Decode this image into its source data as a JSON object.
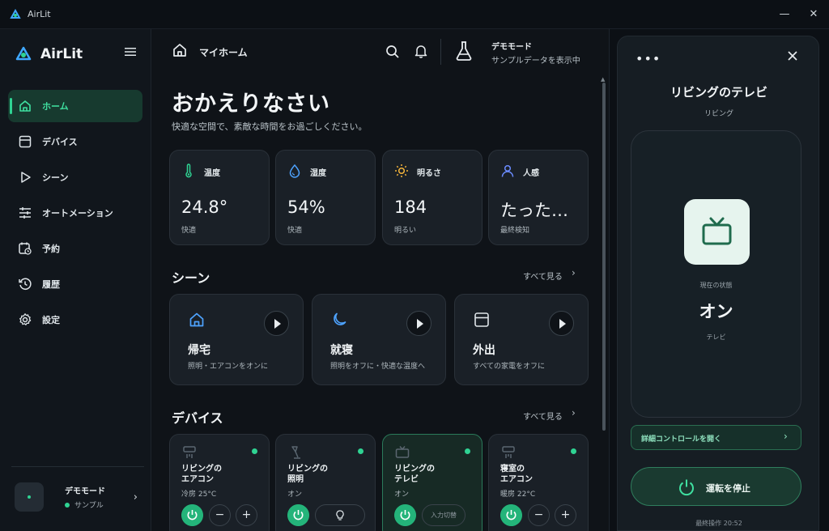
{
  "window": {
    "title": "AirLit",
    "minimize": "—",
    "close": "✕"
  },
  "sidebar": {
    "brand": "AirLit",
    "items": [
      {
        "label": "ホーム",
        "icon": "home-icon",
        "active": true
      },
      {
        "label": "デバイス",
        "icon": "device-icon"
      },
      {
        "label": "シーン",
        "icon": "play-icon"
      },
      {
        "label": "オートメーション",
        "icon": "sliders-icon"
      },
      {
        "label": "予約",
        "icon": "calendar-clock-icon"
      },
      {
        "label": "履歴",
        "icon": "history-icon"
      },
      {
        "label": "設定",
        "icon": "gear-icon"
      }
    ],
    "user": {
      "name": "デモモード",
      "status": "サンプル",
      "chevron": "›"
    }
  },
  "header": {
    "breadcrumb": "マイホーム",
    "demo_title": "デモモード",
    "demo_sub": "サンプルデータを表示中"
  },
  "main": {
    "greeting": "おかえりなさい",
    "greeting_sub": "快適な空間で、素敵な時間をお過ごしください。",
    "sensors": [
      {
        "label": "温度",
        "value": "24.8°",
        "sub": "快適",
        "icon": "thermometer-icon",
        "color": "#2fd393"
      },
      {
        "label": "湿度",
        "value": "54%",
        "sub": "快適",
        "icon": "droplet-icon",
        "color": "#4ea3ff"
      },
      {
        "label": "明るさ",
        "value": "184",
        "sub": "明るい",
        "icon": "sun-icon",
        "color": "#f4b43a"
      },
      {
        "label": "人感",
        "value": "たった…",
        "sub": "最終検知",
        "icon": "person-icon",
        "color": "#6b8cff"
      }
    ],
    "scenes_title": "シーン",
    "scenes_see_all": "すべて見る",
    "scenes": [
      {
        "name": "帰宅",
        "desc": "照明・エアコンをオンに",
        "icon": "home-icon",
        "color": "#4ea3ff"
      },
      {
        "name": "就寝",
        "desc": "照明をオフに・快適な温度へ",
        "icon": "moon-icon",
        "color": "#4ea3ff"
      },
      {
        "name": "外出",
        "desc": "すべての家電をオフに",
        "icon": "device-icon",
        "color": "#dfe5e9"
      }
    ],
    "devices_title": "デバイス",
    "devices_see_all": "すべて見る",
    "devices": [
      {
        "name": "リビングの\nエアコン",
        "status": "冷房 25°C",
        "minus": "−",
        "plus": "+"
      },
      {
        "name": "リビングの\n照明",
        "status": "オン"
      },
      {
        "name": "リビングの\nテレビ",
        "status": "オン",
        "pill": "入力切替"
      },
      {
        "name": "寝室の\nエアコン",
        "status": "暖房 22°C",
        "minus": "−",
        "plus": "+"
      }
    ]
  },
  "panel": {
    "menu": "•••",
    "title": "リビングのテレビ",
    "room": "リビング",
    "state_label": "現在の状態",
    "state": "オン",
    "kind": "テレビ",
    "detail_button": "詳細コントロールを開く",
    "detail_chevron": "›",
    "stop_button": "運転を停止",
    "last_op": "最終操作 20:52"
  },
  "colors": {
    "accent": "#2fd393",
    "surface": "#1a2027",
    "background": "#0f1318"
  }
}
